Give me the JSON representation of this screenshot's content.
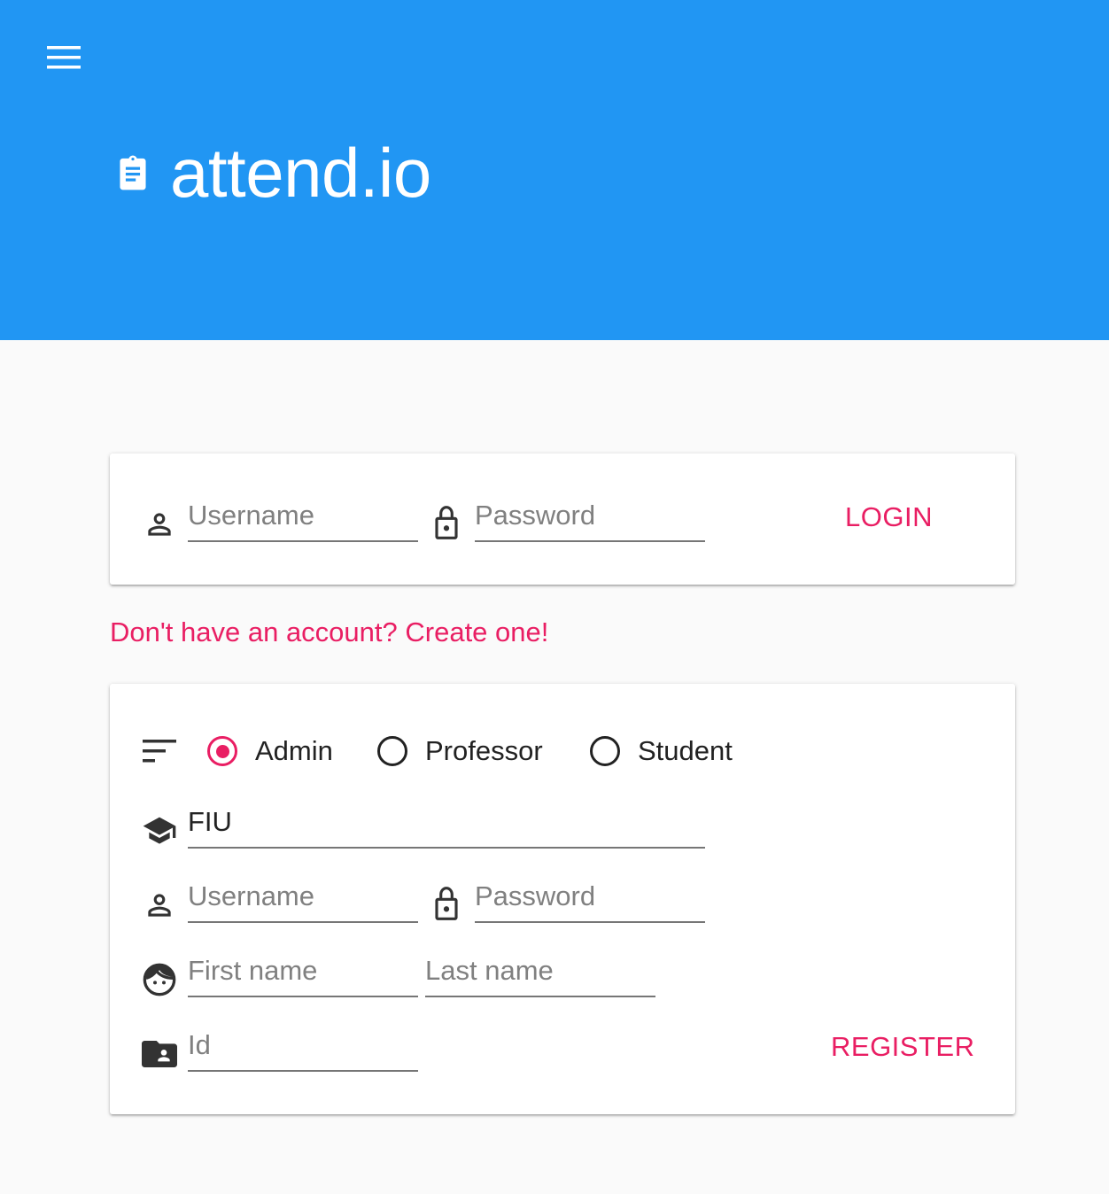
{
  "app": {
    "title": "attend.io",
    "brand_color": "#2196f3",
    "accent_color": "#e91e63"
  },
  "header": {
    "menu_icon": "hamburger-menu-icon",
    "logo_icon": "clipboard-icon"
  },
  "login": {
    "username_placeholder": "Username",
    "password_placeholder": "Password",
    "login_label": "LOGIN"
  },
  "create_account_link": "Don't have an account? Create one!",
  "register": {
    "role_icon": "sort-icon",
    "roles": [
      {
        "label": "Admin",
        "checked": true
      },
      {
        "label": "Professor",
        "checked": false
      },
      {
        "label": "Student",
        "checked": false
      }
    ],
    "school_value": "FIU",
    "username_placeholder": "Username",
    "password_placeholder": "Password",
    "first_name_placeholder": "First name",
    "last_name_placeholder": "Last name",
    "id_placeholder": "Id",
    "register_label": "REGISTER"
  }
}
